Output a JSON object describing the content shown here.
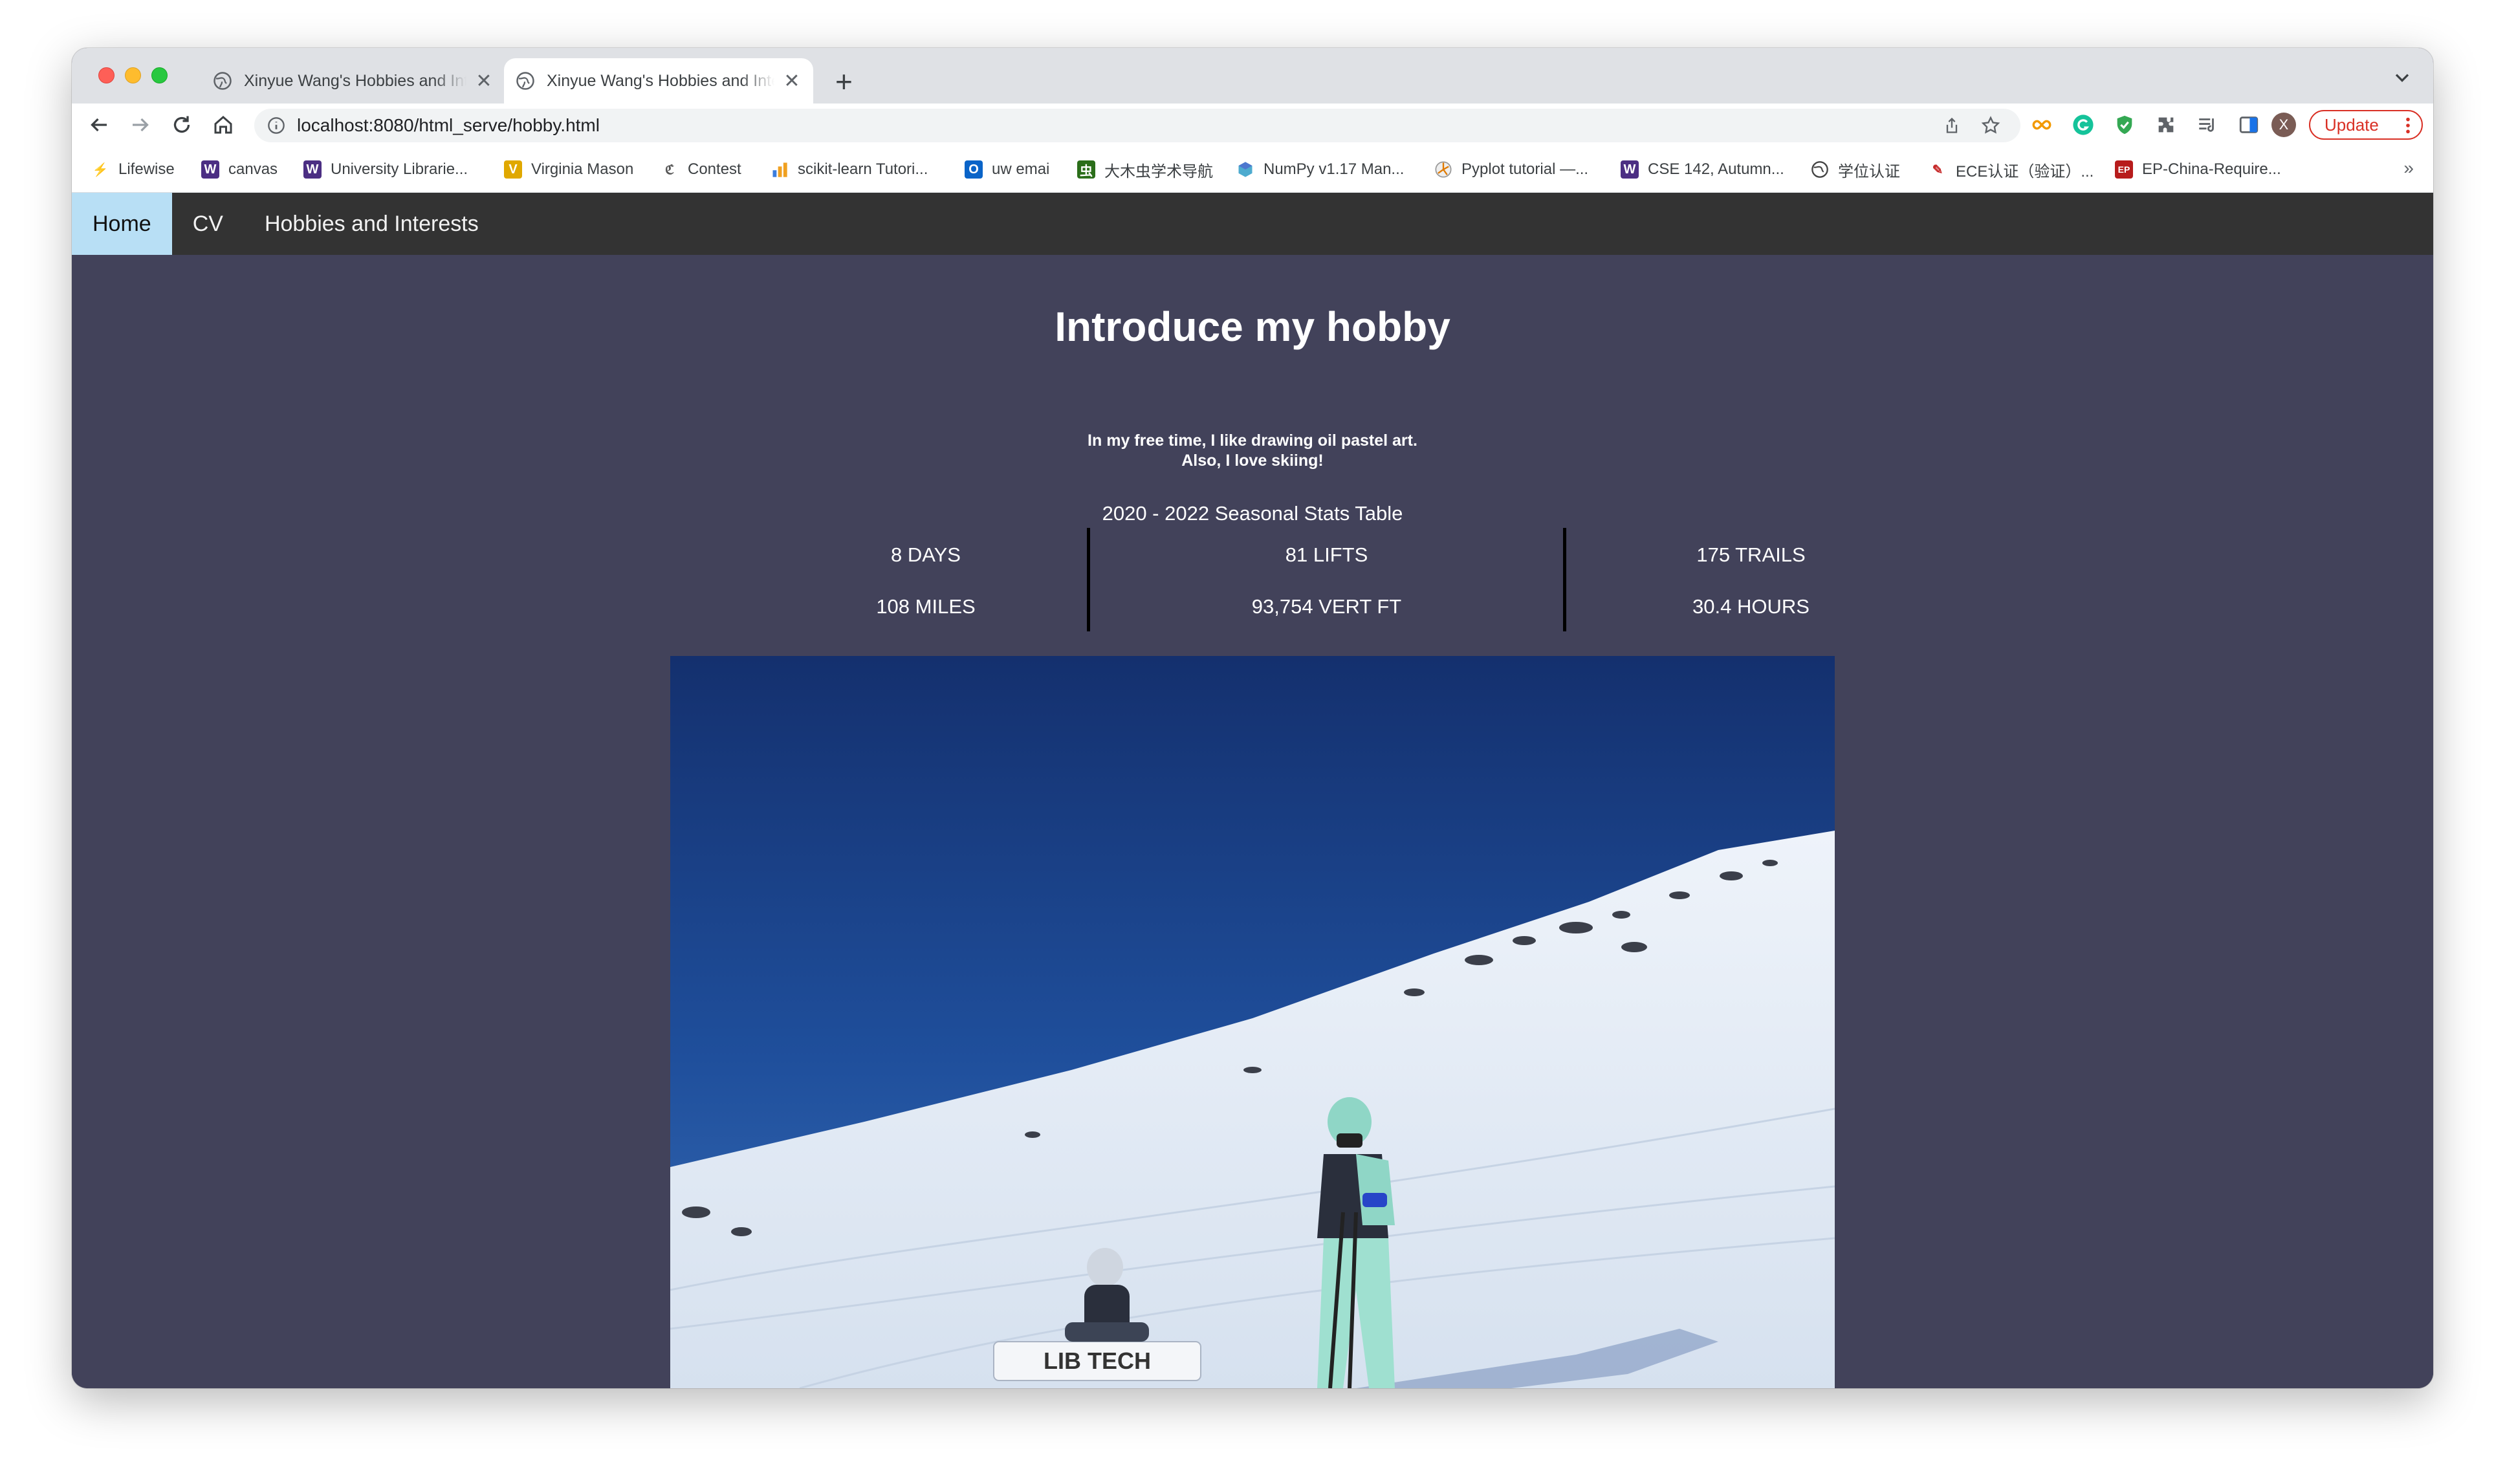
{
  "browser": {
    "tabs": [
      {
        "title": "Xinyue Wang's Hobbies and Interests",
        "active": false
      },
      {
        "title": "Xinyue Wang's Hobbies and Interests",
        "active": true
      }
    ],
    "url": "localhost:8080/html_serve/hobby.html",
    "update_label": "Update",
    "profile_initial": "X",
    "bookmarks": [
      {
        "label": "Lifewise",
        "icon": "lifewise-icon",
        "color": "#2e7d32"
      },
      {
        "label": "canvas",
        "icon": "w-icon",
        "color": "#4b2e83"
      },
      {
        "label": "University Librarie...",
        "icon": "w-icon",
        "color": "#4b2e83"
      },
      {
        "label": "Virginia Mason",
        "icon": "vm-icon",
        "color": "#e0a800"
      },
      {
        "label": "Contest",
        "icon": "contest-icon",
        "color": "#666666"
      },
      {
        "label": "scikit-learn Tutori...",
        "icon": "chart-icon",
        "color": "#f0a020"
      },
      {
        "label": "uw emai",
        "icon": "outlook-icon",
        "color": "#0a64c8"
      },
      {
        "label": "大木虫学术导航",
        "icon": "bug-icon",
        "color": "#2b6e1a"
      },
      {
        "label": "NumPy v1.17 Man...",
        "icon": "numpy-icon",
        "color": "#4d77cf"
      },
      {
        "label": "Pyplot tutorial —...",
        "icon": "matplotlib-icon",
        "color": "#888888"
      },
      {
        "label": "CSE 142, Autumn...",
        "icon": "w-icon",
        "color": "#4b2e83"
      },
      {
        "label": "学位认证",
        "icon": "globe-icon",
        "color": "#444444"
      },
      {
        "label": "ECE认证（验证）...",
        "icon": "pen-icon",
        "color": "#c62828"
      },
      {
        "label": "EP-China-Require...",
        "icon": "ep-icon",
        "color": "#b71c1c"
      }
    ]
  },
  "nav": {
    "items": [
      {
        "label": "Home",
        "active": true
      },
      {
        "label": "CV",
        "active": false
      },
      {
        "label": "Hobbies and Interests",
        "active": false
      }
    ]
  },
  "main": {
    "title": "Introduce my hobby",
    "intro_line1": "In my free time, I like drawing oil pastel art.",
    "intro_line2": "Also, I love skiing!",
    "stats_caption": "2020 - 2022 Seasonal Stats Table",
    "stats": [
      [
        "8 DAYS",
        "81 LIFTS",
        "175 TRAILS"
      ],
      [
        "108 MILES",
        "93,754 VERT FT",
        "30.4 HOURS"
      ]
    ],
    "photo_text": "LIB TECH"
  }
}
